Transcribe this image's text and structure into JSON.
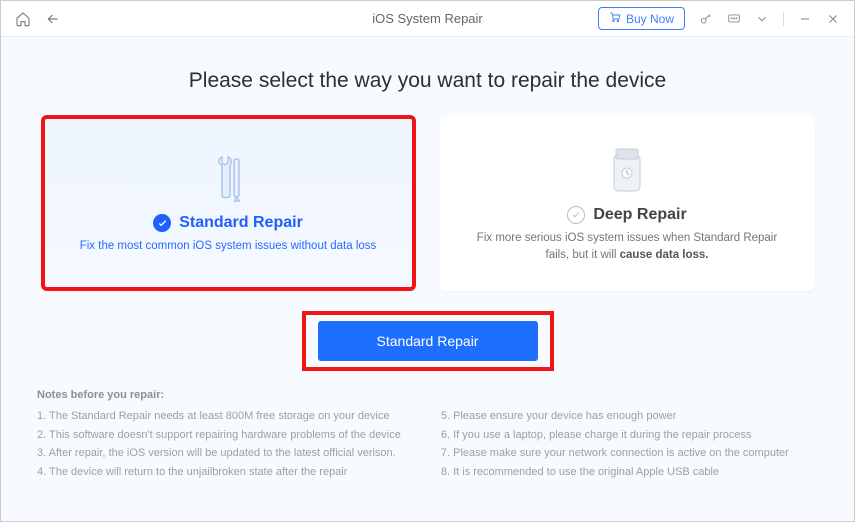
{
  "titlebar": {
    "title": "iOS System Repair",
    "buy_label": "Buy Now"
  },
  "main": {
    "heading": "Please select the way you want to repair the device",
    "standard": {
      "title": "Standard Repair",
      "desc": "Fix the most common iOS system issues without data loss"
    },
    "deep": {
      "title": "Deep Repair",
      "desc_prefix": "Fix more serious iOS system issues when Standard Repair fails, but it will ",
      "desc_bold": "cause data loss."
    },
    "primary_button": "Standard Repair"
  },
  "notes": {
    "title": "Notes before you repair:",
    "left": [
      "1.  The Standard Repair needs at least 800M free storage on your device",
      "2.  This software doesn't support repairing hardware problems of the device",
      "3.  After repair, the iOS version will be updated to the latest official verison.",
      "4.  The device will return to the unjailbroken state after the repair"
    ],
    "right": [
      "5.  Please ensure your device has enough power",
      "6.  If you use a laptop, please charge it during the repair process",
      "7.  Please make sure your network connection is active on the computer",
      "8.  It is recommended to use the original Apple USB cable"
    ]
  }
}
